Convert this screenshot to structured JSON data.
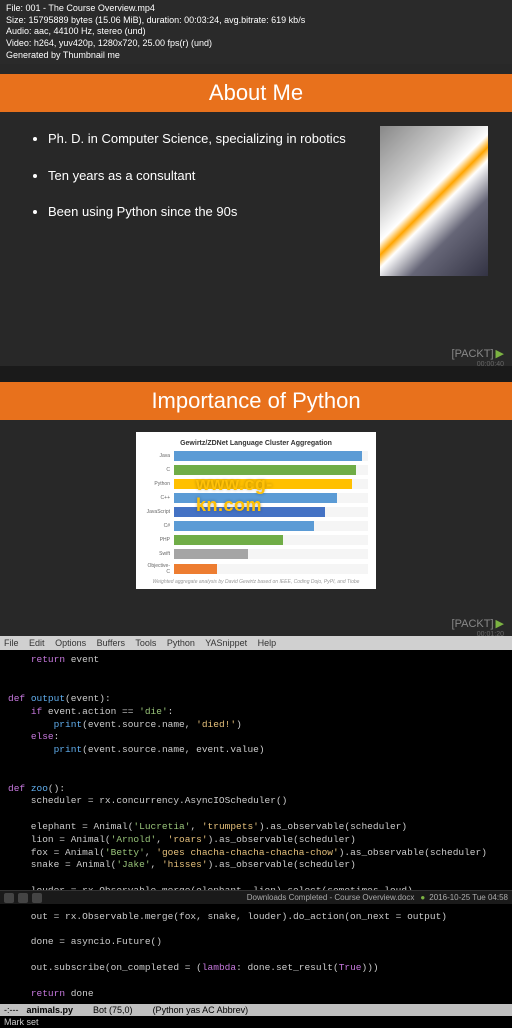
{
  "header": {
    "line1": "File: 001 - The Course Overview.mp4",
    "line2": "Size: 15795889 bytes (15.06 MiB), duration: 00:03:24, avg.bitrate: 619 kb/s",
    "line3": "Audio: aac, 44100 Hz, stereo (und)",
    "line4": "Video: h264, yuv420p, 1280x720, 25.00 fps(r) (und)",
    "line5": "Generated by Thumbnail me"
  },
  "slide1": {
    "title": "About Me",
    "bullets": [
      "Ph. D. in Computer Science, specializing in robotics",
      "Ten years as a consultant",
      "Been using Python since the 90s"
    ],
    "brand": "PACKT",
    "ts": "00:00:40"
  },
  "slide2": {
    "title": "Importance of Python",
    "brand": "PACKT",
    "ts": "00:01:20",
    "watermark": "www.cg-kn.com"
  },
  "chart_data": {
    "type": "bar",
    "orientation": "horizontal",
    "title": "Gewirtz/ZDNet Language Cluster Aggregation",
    "categories": [
      "Java",
      "C",
      "Python",
      "C++",
      "JavaScript",
      "C#",
      "PHP",
      "Swift",
      "Objective-C"
    ],
    "values": [
      97,
      94,
      92,
      84,
      78,
      72,
      56,
      38,
      22
    ],
    "colors": [
      "#5b9bd5",
      "#70ad47",
      "#ffc000",
      "#5b9bd5",
      "#4472c4",
      "#5b9bd5",
      "#70ad47",
      "#a5a5a5",
      "#ed7d31"
    ],
    "xlim": [
      0,
      100
    ],
    "footer": "Weighted aggregate analysis by David Gewirtz based on IEEE, Coding Dojo, PyPI, and Tiobe"
  },
  "editor": {
    "menu": [
      "File",
      "Edit",
      "Options",
      "Buffers",
      "Tools",
      "Python",
      "YASnippet",
      "Help"
    ],
    "status_file": "animals.py",
    "status_pos": "Bot (75,0)",
    "status_mode": "(Python yas AC Abbrev)",
    "mini": "Mark set"
  },
  "taskbar": {
    "notif": "Downloads Completed - Course Overview.docx",
    "date": "2016-10-25 Tue 04:58"
  }
}
